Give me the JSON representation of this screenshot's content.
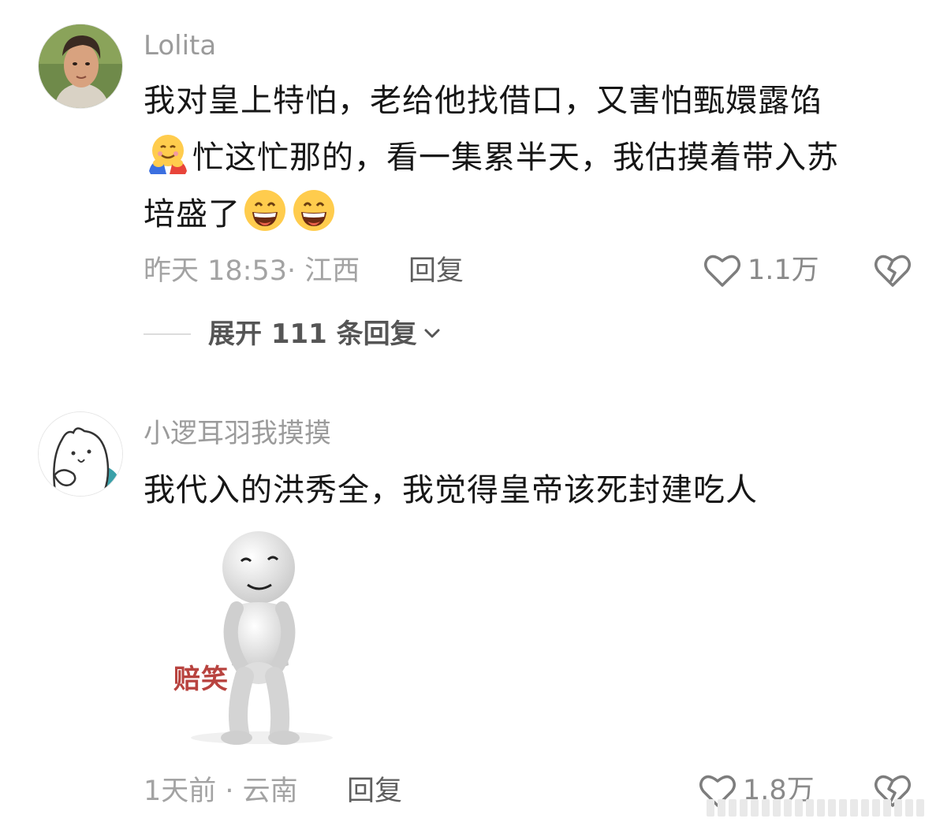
{
  "comments": [
    {
      "username": "Lolita",
      "text_line1": "我对皇上特怕，老给他找借口，又害怕甄嬛露馅",
      "text_line2": "忙这忙那的，看一集累半天，我估摸着带入苏",
      "text_line3": "培盛了",
      "emojis": [
        "hugging-face-emoji",
        "grinning-face-emoji",
        "grinning-face-emoji"
      ],
      "meta": "昨天 18:53· 江西",
      "reply_label": "回复",
      "like_count": "1.1万",
      "expand_label": "展开 111 条回复"
    },
    {
      "username": "小逻耳羽我摸摸",
      "text": "我代入的洪秀全，我觉得皇帝该死封建吃人",
      "sticker_caption": "赔笑",
      "meta": "1天前 · 云南",
      "reply_label": "回复",
      "like_count": "1.8万"
    }
  ],
  "icons": {
    "like": "heart-outline-icon",
    "dislike": "broken-heart-icon",
    "expand": "chevron-down-icon"
  },
  "colors": {
    "text": "#161616",
    "meta": "#a3a3a3",
    "username": "#9b9b9b",
    "sticker_caption": "#b8433f"
  }
}
